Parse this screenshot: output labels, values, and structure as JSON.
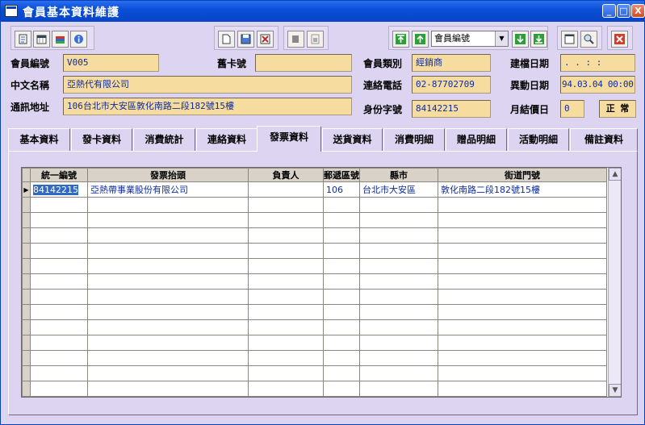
{
  "window": {
    "title": "會員基本資料維護",
    "controls": {
      "minimize": "_",
      "maximize": "□",
      "close": "X"
    }
  },
  "toolbar": {
    "dropdown_value": "會員編號",
    "group1": [
      "report-icon",
      "calendar-icon",
      "books-icon",
      "info-icon"
    ],
    "group2": [
      "new-icon",
      "save-icon",
      "delete-icon"
    ],
    "group3": [
      "undo-icon",
      "print-icon"
    ],
    "group4": [
      "first-icon",
      "prev-icon",
      "next-icon",
      "last-icon"
    ],
    "group5": [
      "window-icon",
      "search-icon"
    ],
    "group6": [
      "exit-icon"
    ]
  },
  "form": {
    "member_no": {
      "label": "會員編號",
      "value": "V005"
    },
    "old_card": {
      "label": "舊卡號",
      "value": ""
    },
    "member_type": {
      "label": "會員類別",
      "value": "經銷商"
    },
    "created": {
      "label": "建檔日期",
      "value": " . .  : :"
    },
    "cname": {
      "label": "中文名稱",
      "value": "亞熱代有限公司"
    },
    "phone": {
      "label": "連絡電話",
      "value": "02-87702709"
    },
    "changed": {
      "label": "異動日期",
      "value": "94.03.04 00:00:00"
    },
    "address": {
      "label": "通訊地址",
      "value": "106台北市大安區敦化南路二段182號15樓"
    },
    "idno": {
      "label": "身份字號",
      "value": "84142215"
    },
    "monthly": {
      "label": "月結價日",
      "value": "0",
      "status": "正  常"
    }
  },
  "tabs": [
    "基本資料",
    "發卡資料",
    "消費統計",
    "連絡資料",
    "發票資料",
    "送貨資料",
    "消費明細",
    "贈品明細",
    "活動明細",
    "備註資料"
  ],
  "selected_tab": "發票資料",
  "grid": {
    "columns": [
      "統一編號",
      "發票抬頭",
      "負責人",
      "郵遞區號",
      "縣市",
      "街道門號"
    ],
    "rows": [
      [
        "84142215",
        "亞熱帶事業股份有限公司",
        "",
        "106",
        "台北市大安區",
        "敦化南路二段182號15樓"
      ]
    ],
    "empty_rows": 13
  },
  "colors": {
    "title_bar": "#0a4fd6",
    "field_bg": "#f7dca0",
    "client_bg": "#dcd4f0",
    "value_text": "#0d2c9c"
  }
}
